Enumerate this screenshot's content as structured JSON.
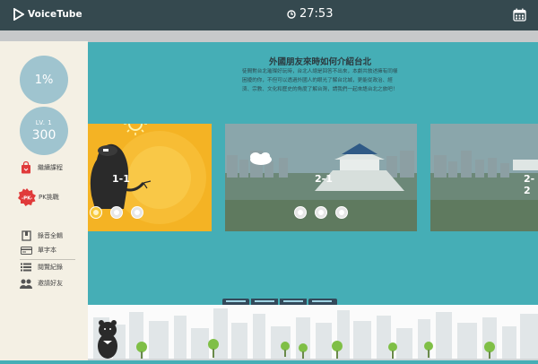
{
  "header": {
    "logo_text": "VoiceTube",
    "timer": "27:53",
    "calendar_icon": "calendar-icon"
  },
  "sidebar": {
    "progress": "1%",
    "level_label": "LV. 1",
    "points": "300",
    "items_top": [
      {
        "label": "繼續課程",
        "icon": "bag-icon"
      },
      {
        "label": "PK挑戰",
        "icon": "pk-badge-icon",
        "badge": "-PK-"
      }
    ],
    "items_bottom": [
      {
        "label": "錄音全輯",
        "icon": "book-icon"
      },
      {
        "label": "單字本",
        "icon": "card-icon"
      },
      {
        "label": "閱覽紀錄",
        "icon": "list-icon"
      },
      {
        "label": "邀請好友",
        "icon": "friends-icon"
      }
    ]
  },
  "main": {
    "title": "外國朋友來時如何介紹台北",
    "description": "徒間對台北璀璨好玩時，台北人總是回答不出來，本劇共敘述擁有同樣困擾的你，不但可以透過外國人的眼光了解台北城，更能從政治、經濟、宗教、文化和歷史的角度了解台灣，請我們一起來語台北之旅吧！",
    "cards": [
      {
        "label": "1-1",
        "stars_on": 1,
        "stars_total": 3
      },
      {
        "label": "2-1",
        "stars_on": 0,
        "stars_total": 3
      },
      {
        "label": "2-2",
        "stars_on": 0,
        "stars_total": 3
      }
    ]
  },
  "colors": {
    "header_bg": "#35494f",
    "page_bg": "#45aeb6",
    "sidebar_bg": "#f4f0e4",
    "card_yellow": "#f4b324",
    "circle": "#9fc4cf"
  }
}
